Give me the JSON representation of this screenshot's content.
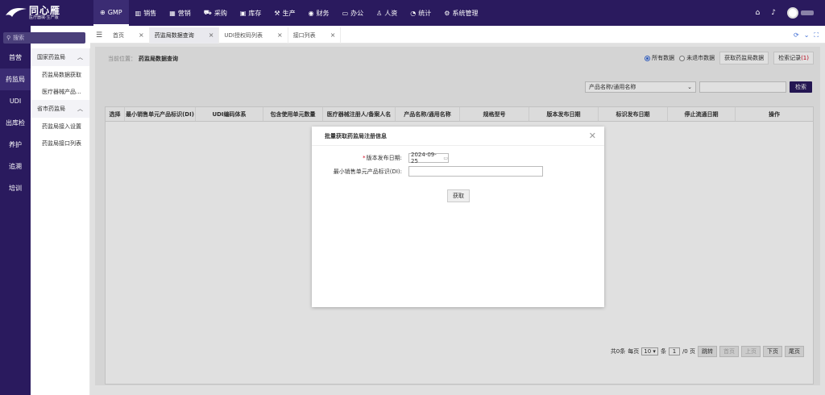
{
  "brand": {
    "title": "同心雁",
    "subtitle": "医疗器械·生产版"
  },
  "nav": [
    {
      "label": "GMP",
      "icon": "⊕"
    },
    {
      "label": "销售",
      "icon": "▥"
    },
    {
      "label": "营销",
      "icon": "▦"
    },
    {
      "label": "采购",
      "icon": "⛟"
    },
    {
      "label": "库存",
      "icon": "▣"
    },
    {
      "label": "生产",
      "icon": "⚒"
    },
    {
      "label": "财务",
      "icon": "◉"
    },
    {
      "label": "办公",
      "icon": "▭"
    },
    {
      "label": "人资",
      "icon": "♙"
    },
    {
      "label": "统计",
      "icon": "◔"
    },
    {
      "label": "系统管理",
      "icon": "⚙"
    }
  ],
  "top_icons": {
    "home": "⌂",
    "bell": "♪"
  },
  "search": {
    "placeholder": "搜索"
  },
  "rail": [
    "首营",
    "药监局",
    "UDI",
    "出库检",
    "养护",
    "追溯",
    "培训"
  ],
  "subnav": {
    "groups": [
      {
        "label": "国家药监局",
        "items": [
          "药监局数据获取",
          "医疗器械产品..."
        ]
      },
      {
        "label": "省市药监局",
        "items": [
          "药监局接入设置",
          "药监局接口列表"
        ]
      }
    ]
  },
  "tabs": [
    "首页",
    "药监局数据查询",
    "UDI授权码列表",
    "接口列表"
  ],
  "breadcrumb": {
    "prefix": "当前位置：",
    "current": "药监局数据查询"
  },
  "filters": {
    "radio_all": "所有数据",
    "radio_unlisted": "未退市数据",
    "fetch_button": "获取药监局数据",
    "records_label": "检索记录",
    "records_count": "(1)"
  },
  "search_row": {
    "select_value": "产品名称/通用名称",
    "search_button": "检索"
  },
  "table_headers": [
    "选择",
    "最小销售单元产品标识(DI)",
    "UDI编码体系",
    "包含使用单元数量",
    "医疗器械注册人/备案人名",
    "产品名称/通用名称",
    "规格型号",
    "版本发布日期",
    "标识发布日期",
    "停止流通日期",
    "操作"
  ],
  "pager": {
    "total": "共0条",
    "per_page_label": "每页",
    "per_page": "10",
    "unit": "条",
    "page": "1",
    "pages": "/0 页",
    "jump": "跳转",
    "first": "首页",
    "prev": "上页",
    "next": "下页",
    "last": "尾页"
  },
  "modal": {
    "title": "批量获取药监局注册信息",
    "date_label": "版本发布日期:",
    "date_value": "2024-09-25",
    "di_label": "最小销售单元产品标识(DI):",
    "submit": "获取"
  }
}
